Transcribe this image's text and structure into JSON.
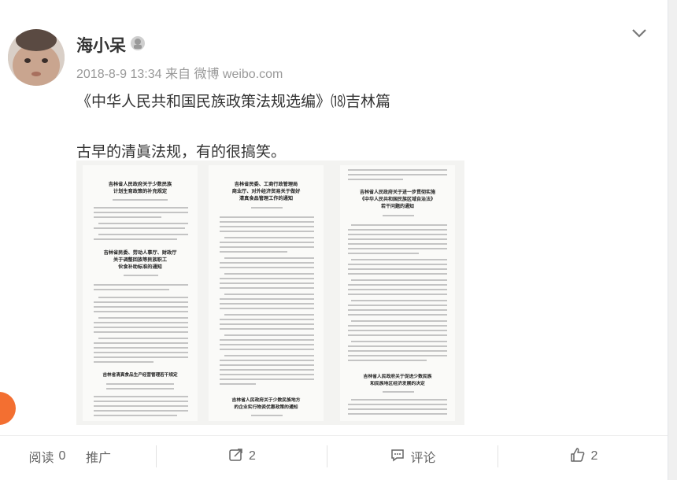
{
  "post": {
    "author": "海小呆",
    "timestamp": "2018-8-9 13:34",
    "source_prefix": "来自",
    "source": "微博 weibo.com",
    "text_line1": "《中华人民共和国民族政策法规选编》⒅吉林篇",
    "text_line2": "古早的清眞法规，有的很搞笑。"
  },
  "doc_titles": {
    "p1_t1a": "吉林省人民政府关于少数民族",
    "p1_t1b": "计划生育政策的补充规定",
    "p1_t2a": "吉林省民委、劳动人事厅、财政厅",
    "p1_t2b": "关于调整回族等民族职工",
    "p1_t2c": "伙食补助标准的通知",
    "p1_t3": "吉林省清真食品生产经营管理若干规定",
    "p2_t1a": "吉林省民委、工商行政管理局",
    "p2_t1b": "商业厅、对外经济贸易关于做好",
    "p2_t1c": "清真食品管理工作的通知",
    "p2_t2a": "吉林省人民政府关于少数民族地方",
    "p2_t2b": "的企业实行物资优惠政策的通知",
    "p3_t1a": "吉林省人民政府关于进一步贯彻实施",
    "p3_t1b": "《中华人民共和国民族区域自治法》",
    "p3_t1c": "若干问题的通知",
    "p3_t2a": "吉林省人民政府关于促进少数民族",
    "p3_t2b": "和民族地区经济发展的决定"
  },
  "footer": {
    "read_label": "阅读",
    "read_count": "0",
    "promote": "推广",
    "forward_count": "2",
    "comment": "评论",
    "like_count": "2"
  },
  "colors": {
    "accent": "#f36f31",
    "text": "#333333",
    "muted": "#999999"
  }
}
